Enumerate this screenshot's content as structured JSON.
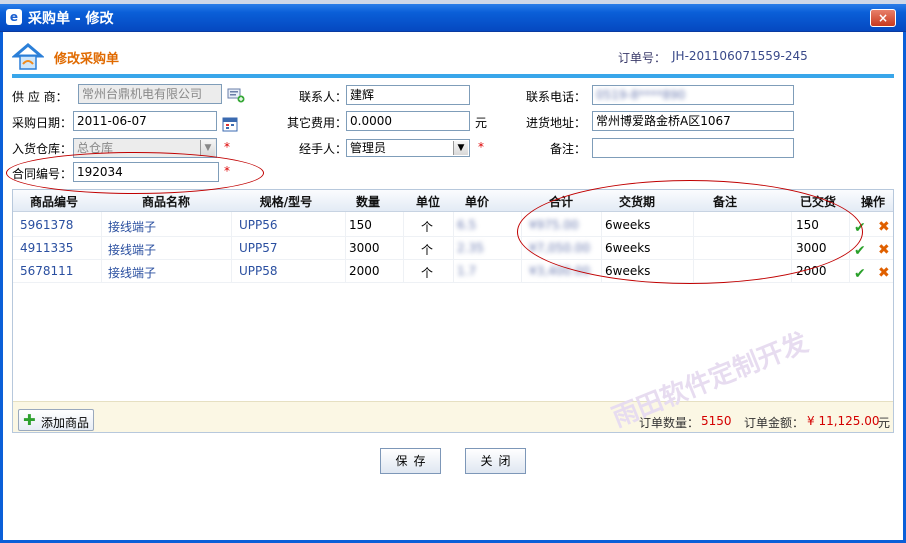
{
  "window": {
    "title": "采购单 - 修改",
    "close_label": "×"
  },
  "page": {
    "title": "修改采购单",
    "order_no_label": "订单号：",
    "order_no": "JH-201106071559-245"
  },
  "form": {
    "supplier_label": "供 应 商：",
    "supplier_value": "常州台鼎机电有限公司",
    "contact_label": "联系人：",
    "contact_value": "建辉",
    "phone_label": "联系电话：",
    "phone_value": "0519-8****890",
    "date_label": "采购日期：",
    "date_value": "2011-06-07",
    "other_fee_label": "其它费用：",
    "other_fee_value": "0.0000",
    "other_fee_unit": "元",
    "address_label": "进货地址：",
    "address_value": "常州博爱路金桥A区1067",
    "warehouse_label": "入货仓库：",
    "warehouse_value": "总仓库",
    "handler_label": "经手人：",
    "handler_value": "管理员",
    "remark_label": "备注：",
    "remark_value": "",
    "contract_label": "合同编号：",
    "contract_value": "192034",
    "required_mark": "*"
  },
  "table": {
    "headers": [
      "商品编号",
      "商品名称",
      "规格/型号",
      "数量",
      "单位",
      "单价",
      "合计",
      "交货期",
      "备注",
      "已交货",
      "操作"
    ],
    "rows": [
      {
        "code": "5961378",
        "name": "接线端子",
        "spec": "UPP56",
        "qty": "150",
        "unit": "个",
        "price": "6.5",
        "total": "¥975.00",
        "delivery": "6weeks",
        "remark": "",
        "delivered": "150"
      },
      {
        "code": "4911335",
        "name": "接线端子",
        "spec": "UPP57",
        "qty": "3000",
        "unit": "个",
        "price": "2.35",
        "total": "¥7,050.00",
        "delivery": "6weeks",
        "remark": "",
        "delivered": "3000"
      },
      {
        "code": "5678111",
        "name": "接线端子",
        "spec": "UPP58",
        "qty": "2000",
        "unit": "个",
        "price": "1.7",
        "total": "¥3,400.00",
        "delivery": "6weeks",
        "remark": "",
        "delivered": "2000"
      }
    ]
  },
  "footer": {
    "add_label": "添加商品",
    "qty_label": "订单数量：",
    "qty_value": "5150",
    "amount_label": "订单金额：",
    "amount_value": "¥ 11,125.00",
    "amount_unit": "元"
  },
  "buttons": {
    "save": "保存",
    "close": "关闭"
  },
  "watermark": "雨田软件定制开发",
  "colors": {
    "title_bar": "#0a5fd8",
    "accent": "#e06a00",
    "divider": "#39a6ea",
    "highlight": "#c00000"
  }
}
